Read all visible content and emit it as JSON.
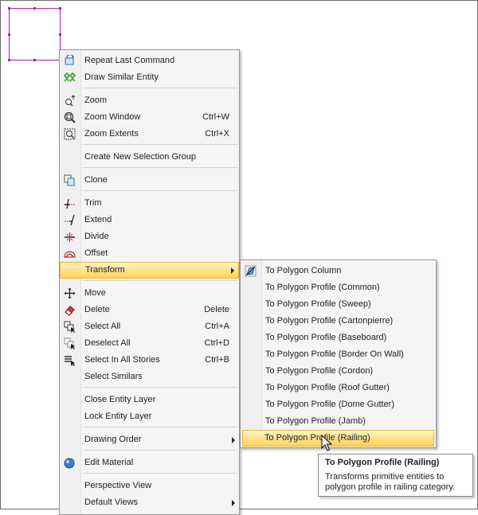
{
  "colors": {
    "selection": "#b01fb0",
    "highlight": "#ffd35b",
    "menu_bg": "#f5f5f5"
  },
  "context_menu": {
    "items": [
      {
        "label": "Repeat Last Command",
        "shortcut": "",
        "icon": "repeat-icon"
      },
      {
        "label": "Draw Similar Entity",
        "shortcut": "",
        "icon": "draw-similar-icon"
      },
      {
        "label": "Zoom",
        "shortcut": "",
        "icon": "zoom-icon"
      },
      {
        "label": "Zoom Window",
        "shortcut": "Ctrl+W",
        "icon": "zoom-window-icon"
      },
      {
        "label": "Zoom Extents",
        "shortcut": "Ctrl+X",
        "icon": "zoom-extents-icon"
      },
      {
        "label": "Create New Selection Group",
        "shortcut": "",
        "icon": ""
      },
      {
        "label": "Clone",
        "shortcut": "",
        "icon": "clone-icon"
      },
      {
        "label": "Trim",
        "shortcut": "",
        "icon": "trim-icon"
      },
      {
        "label": "Extend",
        "shortcut": "",
        "icon": "extend-icon"
      },
      {
        "label": "Divide",
        "shortcut": "",
        "icon": "divide-icon"
      },
      {
        "label": "Offset",
        "shortcut": "",
        "icon": "offset-icon"
      },
      {
        "label": "Transform",
        "shortcut": "",
        "icon": ""
      },
      {
        "label": "Move",
        "shortcut": "",
        "icon": "move-icon"
      },
      {
        "label": "Delete",
        "shortcut": "Delete",
        "icon": "eraser-icon"
      },
      {
        "label": "Select All",
        "shortcut": "Ctrl+A",
        "icon": "select-all-icon"
      },
      {
        "label": "Deselect All",
        "shortcut": "Ctrl+D",
        "icon": "deselect-all-icon"
      },
      {
        "label": "Select In All Stories",
        "shortcut": "Ctrl+B",
        "icon": "select-stories-icon"
      },
      {
        "label": "Select Similars",
        "shortcut": "",
        "icon": ""
      },
      {
        "label": "Close Entity Layer",
        "shortcut": "",
        "icon": ""
      },
      {
        "label": "Lock Entity Layer",
        "shortcut": "",
        "icon": ""
      },
      {
        "label": "Drawing Order",
        "shortcut": "",
        "icon": ""
      },
      {
        "label": "Edit Material",
        "shortcut": "",
        "icon": "material-icon"
      },
      {
        "label": "Perspective View",
        "shortcut": "",
        "icon": ""
      },
      {
        "label": "Default Views",
        "shortcut": "",
        "icon": ""
      }
    ]
  },
  "submenu": {
    "items": [
      {
        "label": "To Polygon Column"
      },
      {
        "label": "To Polygon Profile (Common)"
      },
      {
        "label": "To Polygon Profile (Sweep)"
      },
      {
        "label": "To Polygon Profile (Cartonpierre)"
      },
      {
        "label": "To Polygon Profile (Baseboard)"
      },
      {
        "label": "To Polygon Profile (Border On Wall)"
      },
      {
        "label": "To Polygon Profile (Cordon)"
      },
      {
        "label": "To Polygon Profile (Roof Gutter)"
      },
      {
        "label": "To Polygon Profile (Dome Gutter)"
      },
      {
        "label": "To Polygon Profile (Jamb)"
      },
      {
        "label": "To Polygon Profile (Railing)"
      }
    ]
  },
  "tooltip": {
    "title": "To Polygon Profile (Railing)",
    "body": "Transforms primitive entities to polygon profile in railing category."
  }
}
